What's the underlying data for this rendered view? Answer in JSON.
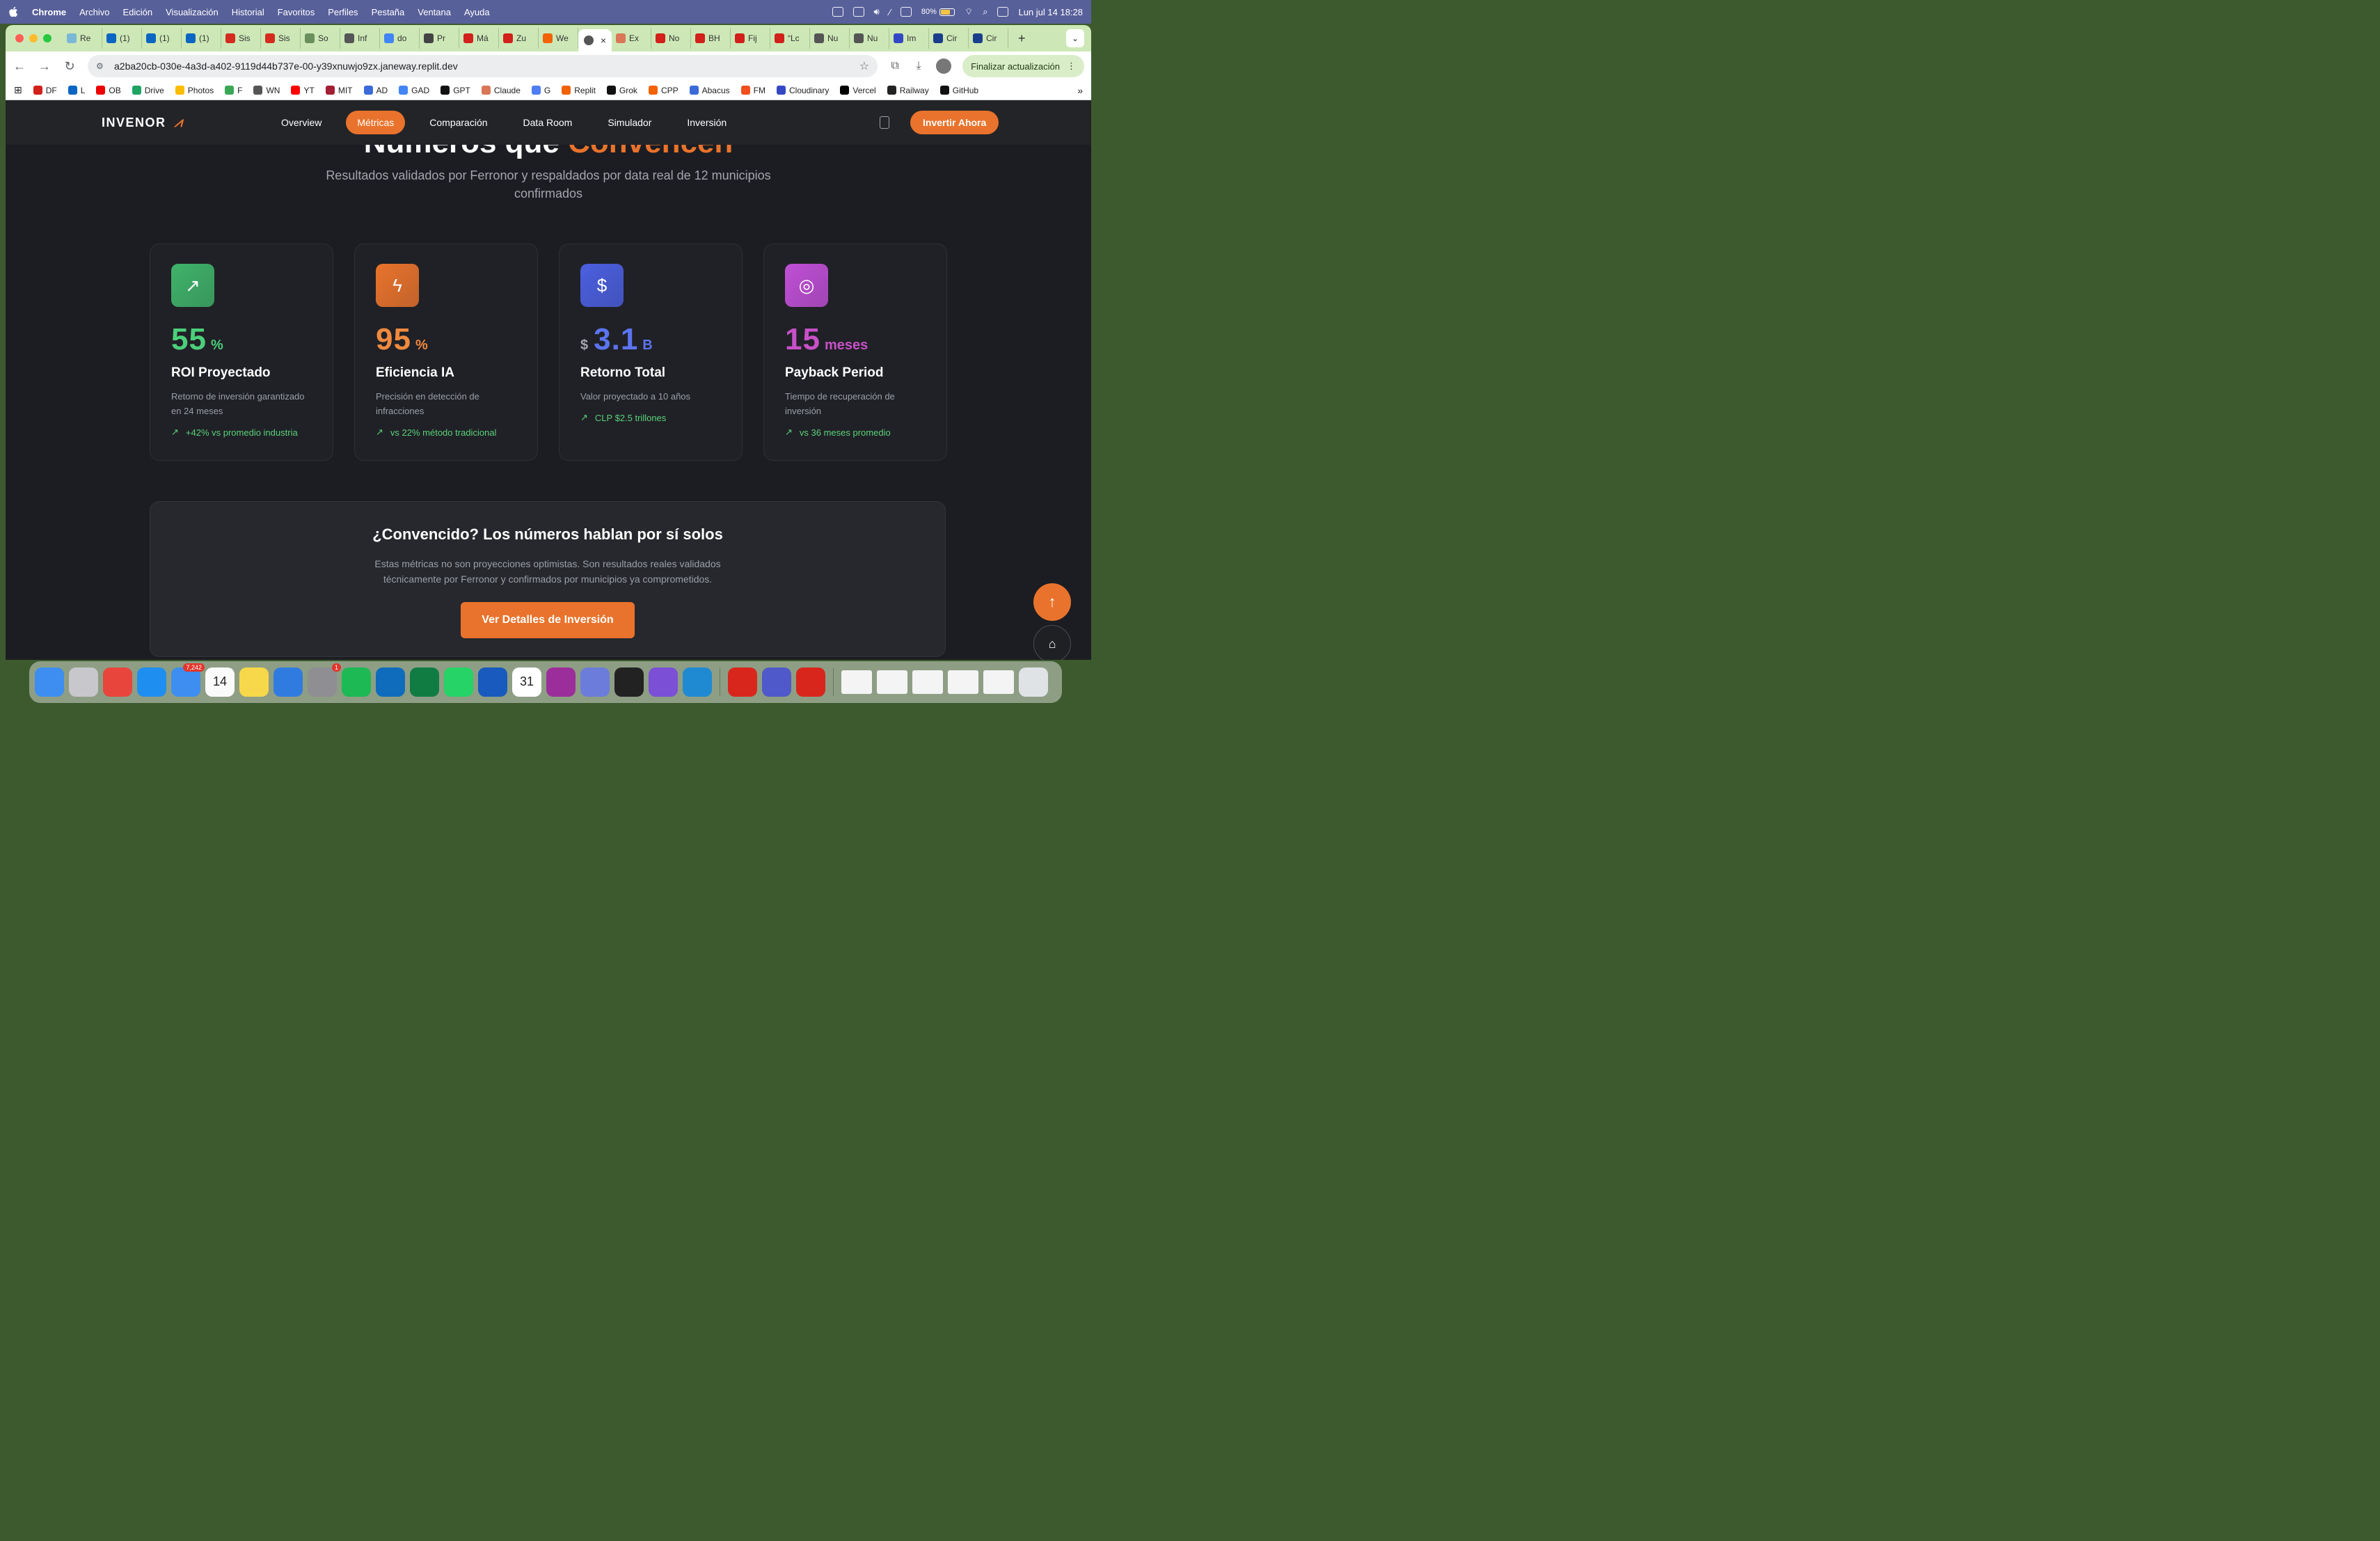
{
  "menubar": {
    "app": "Chrome",
    "items": [
      "Archivo",
      "Edición",
      "Visualización",
      "Historial",
      "Favoritos",
      "Perfiles",
      "Pestaña",
      "Ventana",
      "Ayuda"
    ],
    "battery": "80%",
    "datetime": "Lun jul 14  18:28"
  },
  "tabs": [
    {
      "label": "Re",
      "color": "#7ab8d6"
    },
    {
      "label": "(1)",
      "color": "#0a66c2"
    },
    {
      "label": "(1)",
      "color": "#0a66c2"
    },
    {
      "label": "(1)",
      "color": "#0a66c2"
    },
    {
      "label": "Sis",
      "color": "#d52b1e"
    },
    {
      "label": "Sis",
      "color": "#d52b1e"
    },
    {
      "label": "So",
      "color": "#6a8f5c"
    },
    {
      "label": "Inf",
      "color": "#555"
    },
    {
      "label": "do",
      "color": "#4285f4"
    },
    {
      "label": "Pr",
      "color": "#444"
    },
    {
      "label": "Má",
      "color": "#d2201a"
    },
    {
      "label": "Zu",
      "color": "#d2201a"
    },
    {
      "label": "We",
      "color": "#f26207"
    }
  ],
  "tabs_after": [
    {
      "label": "Ex",
      "color": "#d97757"
    },
    {
      "label": "No",
      "color": "#d2201a"
    },
    {
      "label": "BH",
      "color": "#d2201a"
    },
    {
      "label": "Fij",
      "color": "#d2201a"
    },
    {
      "label": "“Lc",
      "color": "#d2201a"
    },
    {
      "label": "Nu",
      "color": "#555"
    },
    {
      "label": "Nu",
      "color": "#555"
    },
    {
      "label": "Im",
      "color": "#3448c5"
    },
    {
      "label": "Cir",
      "color": "#1a3e8c"
    },
    {
      "label": "Cir",
      "color": "#1a3e8c"
    }
  ],
  "active_tab_close": "×",
  "new_tab": "+",
  "toolbar": {
    "url": "a2ba20cb-030e-4a3d-a402-9119d44b737e-00-y39xnuwjo9zx.janeway.replit.dev",
    "update_label": "Finalizar actualización"
  },
  "bookmarks": [
    {
      "label": "DF",
      "color": "#d2201a"
    },
    {
      "label": "L",
      "color": "#0a66c2"
    },
    {
      "label": "OB",
      "color": "#ec0000"
    },
    {
      "label": "Drive",
      "color": "#1fa463"
    },
    {
      "label": "Photos",
      "color": "#fbbc04"
    },
    {
      "label": "F",
      "color": "#3aa757"
    },
    {
      "label": "WN",
      "color": "#555"
    },
    {
      "label": "YT",
      "color": "#ff0000"
    },
    {
      "label": "MIT",
      "color": "#a31f34"
    },
    {
      "label": "AD",
      "color": "#3a6bd8"
    },
    {
      "label": "GAD",
      "color": "#4285f4"
    },
    {
      "label": "GPT",
      "color": "#111"
    },
    {
      "label": "Claude",
      "color": "#d97757"
    },
    {
      "label": "G",
      "color": "#4f7df3"
    },
    {
      "label": "Replit",
      "color": "#f26207"
    },
    {
      "label": "Grok",
      "color": "#111"
    },
    {
      "label": "CPP",
      "color": "#f26207"
    },
    {
      "label": "Abacus",
      "color": "#3a6bd8"
    },
    {
      "label": "FM",
      "color": "#f24e1e"
    },
    {
      "label": "Cloudinary",
      "color": "#3448c5"
    },
    {
      "label": "Vercel",
      "color": "#000"
    },
    {
      "label": "Railway",
      "color": "#222"
    },
    {
      "label": "GitHub",
      "color": "#111"
    }
  ],
  "site": {
    "logo": "INVENOR",
    "nav": [
      {
        "label": "Overview",
        "active": false
      },
      {
        "label": "Métricas",
        "active": true
      },
      {
        "label": "Comparación",
        "active": false
      },
      {
        "label": "Data Room",
        "active": false
      },
      {
        "label": "Simulador",
        "active": false
      },
      {
        "label": "Inversión",
        "active": false
      }
    ],
    "invest_label": "Invertir Ahora",
    "heading_white": "Números que ",
    "heading_accent": "Convencen",
    "subtitle": "Resultados validados por Ferronor y respaldados por data real de 12 municipios confirmados"
  },
  "cards": [
    {
      "icon": "trending-up-icon",
      "glyph": "↗",
      "icon_bg": "#3fb36a",
      "color": "#4ccf7a",
      "prefix": "",
      "value": "55",
      "unit": "%",
      "title": "ROI Proyectado",
      "desc": "Retorno de inversión garantizado en 24 meses",
      "trend": "+42% vs promedio industria"
    },
    {
      "icon": "lightning-icon",
      "glyph": "ϟ",
      "icon_bg": "#e9732c",
      "color": "#f08a3e",
      "prefix": "",
      "value": "95",
      "unit": "%",
      "title": "Eficiencia IA",
      "desc": "Precisión en detección de infracciones",
      "trend": "vs 22% método tradicional"
    },
    {
      "icon": "dollar-icon",
      "glyph": "$",
      "icon_bg": "#4b5fe0",
      "color": "#5b74f0",
      "prefix": "$",
      "value": "3.1",
      "unit": "B",
      "title": "Retorno Total",
      "desc": "Valor proyectado a 10 años",
      "trend": "CLP $2.5 trillones"
    },
    {
      "icon": "target-icon",
      "glyph": "◎",
      "icon_bg": "#c04fd6",
      "color": "#c850c8",
      "prefix": "",
      "value": "15",
      "unit": "meses",
      "title": "Payback Period",
      "desc": "Tiempo de recuperación de inversión",
      "trend": "vs 36 meses promedio"
    }
  ],
  "cta": {
    "title": "¿Convencido? Los números hablan por sí solos",
    "text": "Estas métricas no son proyecciones optimistas. Son resultados reales validados técnicamente por Ferronor y confirmados por municipios ya comprometidos.",
    "button": "Ver Detalles de Inversión"
  },
  "dock": {
    "apps": [
      {
        "name": "finder",
        "color": "#3d8ef0"
      },
      {
        "name": "launchpad",
        "color": "#c7c7cc"
      },
      {
        "name": "chrome",
        "color": "#e8453c"
      },
      {
        "name": "safari",
        "color": "#1e8ff0"
      },
      {
        "name": "mail",
        "color": "#3d8ef0",
        "badge": "7,242"
      },
      {
        "name": "calendar",
        "color": "#fafafa",
        "label": "14"
      },
      {
        "name": "notes",
        "color": "#f7d84a"
      },
      {
        "name": "keynote",
        "color": "#2f7be0"
      },
      {
        "name": "settings",
        "color": "#8e8e93",
        "badge": "1"
      },
      {
        "name": "spotify",
        "color": "#1db954"
      },
      {
        "name": "outlook",
        "color": "#0f6cbd"
      },
      {
        "name": "excel",
        "color": "#107c41"
      },
      {
        "name": "whatsapp",
        "color": "#25d366"
      },
      {
        "name": "word",
        "color": "#185abd"
      },
      {
        "name": "calendar-31",
        "color": "#ffffff",
        "label": "31"
      },
      {
        "name": "orb",
        "color": "#9b2e9a"
      },
      {
        "name": "iphone-mirror",
        "color": "#6c7cdb"
      },
      {
        "name": "replit",
        "color": "#222222"
      },
      {
        "name": "github-desktop",
        "color": "#7b4fd6"
      },
      {
        "name": "vscode",
        "color": "#1f8ad2"
      },
      {
        "name": "acrobat",
        "color": "#d8261c"
      },
      {
        "name": "teams",
        "color": "#5059c9"
      },
      {
        "name": "photo-booth",
        "color": "#d8261c"
      }
    ]
  }
}
